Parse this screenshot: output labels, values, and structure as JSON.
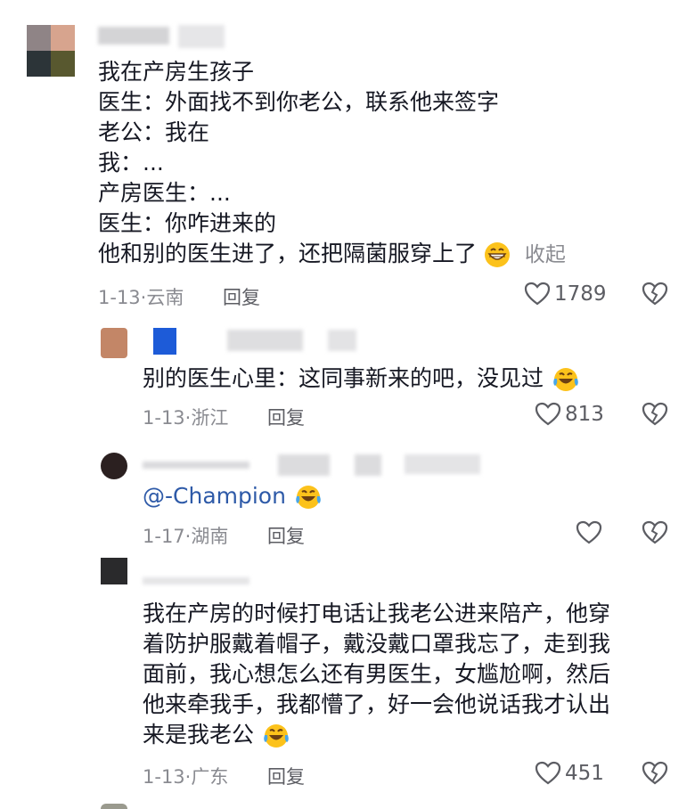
{
  "comments": [
    {
      "lines": [
        "我在产房生孩子",
        "医生：外面找不到你老公，联系他来签字",
        "老公：我在",
        "我：...",
        "产房医生：...",
        "医生：你咋进来的",
        "他和别的医生进了，还把隔菌服穿上了"
      ],
      "collapse": "收起",
      "date": "1-13",
      "location": "云南",
      "reply": "回复",
      "likes": "1789"
    },
    {
      "lines": [
        "别的医生心里：这同事新来的吧，没见过"
      ],
      "date": "1-13",
      "location": "浙江",
      "reply": "回复",
      "likes": "813"
    },
    {
      "lines": [
        "@-Champion"
      ],
      "date": "1-17",
      "location": "湖南",
      "reply": "回复",
      "likes": ""
    },
    {
      "lines": [
        "我在产房的时候打电话让我老公进来陪产，他穿",
        "着防护服戴着帽子，戴没戴口罩我忘了，走到我",
        "面前，我心想怎么还有男医生，女尴尬啊，然后",
        "他来牵我手，我都懵了，好一会他说话我才认出",
        "来是我老公"
      ],
      "date": "1-13",
      "location": "广东",
      "reply": "回复",
      "likes": "451"
    }
  ],
  "colors": {
    "text": "#161823",
    "meta": "#8a8b91",
    "mention": "#2e5aa8",
    "icon": "#5c5d63"
  },
  "icons": {
    "like": "heart-outline-icon",
    "dislike": "broken-heart-icon",
    "laugh": "grin-emoji",
    "cry_laugh": "tears-of-joy-emoji"
  }
}
